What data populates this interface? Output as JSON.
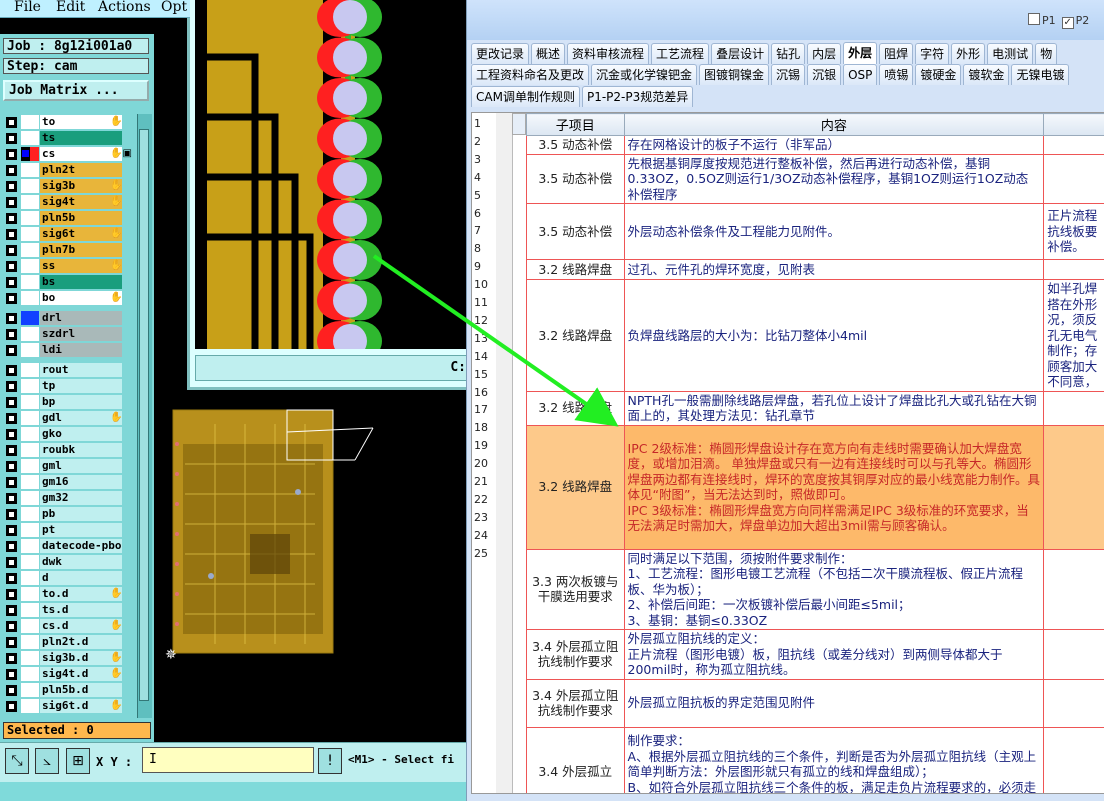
{
  "cam": {
    "menu": [
      "File",
      "Edit",
      "Actions",
      "Opt"
    ],
    "job": "Job : 8g12i001a0",
    "step": "Step: cam",
    "job_matrix_button": "Job Matrix ...",
    "layers": [
      {
        "name": "to",
        "swatch": "#ffffff",
        "bg": "#ffffff",
        "mark": "✋"
      },
      {
        "name": "ts",
        "swatch": "#ffffff",
        "bg": "#1a9e7d",
        "mark": ""
      },
      {
        "name": "cs",
        "swatch": "#ff2020",
        "bg": "#ffffff",
        "mark": "✋▣",
        "active": true
      },
      {
        "name": "pln2t",
        "swatch": "#ffffff",
        "bg": "#e8b53a",
        "mark": ""
      },
      {
        "name": "sig3b",
        "swatch": "#ffffff",
        "bg": "#e8b53a",
        "mark": "✋"
      },
      {
        "name": "sig4t",
        "swatch": "#ffffff",
        "bg": "#e8b53a",
        "mark": "✋"
      },
      {
        "name": "pln5b",
        "swatch": "#ffffff",
        "bg": "#e8b53a",
        "mark": ""
      },
      {
        "name": "sig6t",
        "swatch": "#ffffff",
        "bg": "#e8b53a",
        "mark": "✋"
      },
      {
        "name": "pln7b",
        "swatch": "#ffffff",
        "bg": "#e8b53a",
        "mark": ""
      },
      {
        "name": "ss",
        "swatch": "#ffffff",
        "bg": "#e8b53a",
        "mark": "✋"
      },
      {
        "name": "bs",
        "swatch": "#ffffff",
        "bg": "#1a9e7d",
        "mark": ""
      },
      {
        "name": "bo",
        "swatch": "#ffffff",
        "bg": "#ffffff",
        "mark": "✋"
      },
      {
        "gap": true
      },
      {
        "name": "drl",
        "swatch": "#1040ff",
        "bg": "#a9b9b9",
        "mark": ""
      },
      {
        "name": "szdrl",
        "swatch": "#ffffff",
        "bg": "#a9b9b9",
        "mark": ""
      },
      {
        "name": "ldi",
        "swatch": "#ffffff",
        "bg": "#a9b9b9",
        "mark": ""
      },
      {
        "gap": true
      },
      {
        "name": "rout",
        "swatch": "#ffffff",
        "bg": "#bfefef",
        "mark": ""
      },
      {
        "name": "tp",
        "swatch": "#ffffff",
        "bg": "#bfefef",
        "mark": ""
      },
      {
        "name": "bp",
        "swatch": "#ffffff",
        "bg": "#bfefef",
        "mark": ""
      },
      {
        "name": "gdl",
        "swatch": "#ffffff",
        "bg": "#bfefef",
        "mark": "✋"
      },
      {
        "name": "gko",
        "swatch": "#ffffff",
        "bg": "#bfefef",
        "mark": ""
      },
      {
        "name": "roubk",
        "swatch": "#ffffff",
        "bg": "#bfefef",
        "mark": ""
      },
      {
        "name": "gml",
        "swatch": "#ffffff",
        "bg": "#bfefef",
        "mark": ""
      },
      {
        "name": "gm16",
        "swatch": "#ffffff",
        "bg": "#bfefef",
        "mark": ""
      },
      {
        "name": "gm32",
        "swatch": "#ffffff",
        "bg": "#bfefef",
        "mark": ""
      },
      {
        "name": "pb",
        "swatch": "#ffffff",
        "bg": "#bfefef",
        "mark": ""
      },
      {
        "name": "pt",
        "swatch": "#ffffff",
        "bg": "#bfefef",
        "mark": ""
      },
      {
        "name": "datecode-pbo",
        "swatch": "#ffffff",
        "bg": "#bfefef",
        "mark": ""
      },
      {
        "name": "dwk",
        "swatch": "#ffffff",
        "bg": "#bfefef",
        "mark": ""
      },
      {
        "name": "d",
        "swatch": "#ffffff",
        "bg": "#bfefef",
        "mark": ""
      },
      {
        "name": "to.d",
        "swatch": "#ffffff",
        "bg": "#bfefef",
        "mark": "✋"
      },
      {
        "name": "ts.d",
        "swatch": "#ffffff",
        "bg": "#bfefef",
        "mark": ""
      },
      {
        "name": "cs.d",
        "swatch": "#ffffff",
        "bg": "#bfefef",
        "mark": "✋"
      },
      {
        "name": "pln2t.d",
        "swatch": "#ffffff",
        "bg": "#bfefef",
        "mark": ""
      },
      {
        "name": "sig3b.d",
        "swatch": "#ffffff",
        "bg": "#bfefef",
        "mark": "✋"
      },
      {
        "name": "sig4t.d",
        "swatch": "#ffffff",
        "bg": "#bfefef",
        "mark": "✋"
      },
      {
        "name": "pln5b.d",
        "swatch": "#ffffff",
        "bg": "#bfefef",
        "mark": ""
      },
      {
        "name": "sig6t.d",
        "swatch": "#ffffff",
        "bg": "#bfefef",
        "mark": "✋"
      }
    ],
    "selected": "Selected : 0",
    "xy_label": "X Y :",
    "xy_value": "I",
    "status": "<M1> - Select fi",
    "zoom_footer": "C:"
  },
  "spec": {
    "p_options": [
      {
        "label": "P1",
        "checked": false
      },
      {
        "label": "P2",
        "checked": true
      }
    ],
    "tabs_row1": [
      "更改记录",
      "概述",
      "资料审核流程",
      "工艺流程",
      "叠层设计",
      "钻孔",
      "内层",
      "外层",
      "阻焊",
      "字符",
      "外形",
      "电测试",
      "物"
    ],
    "active_tab": "外层",
    "tabs_row2": [
      "工程资料命名及更改",
      "沉金或化学镍钯金",
      "图镀铜镍金",
      "沉锡",
      "沉银",
      "OSP",
      "喷锡",
      "镀硬金",
      "镀软金",
      "无镍电镀"
    ],
    "tabs_row3": [
      "CAM调单制作规则",
      "P1-P2-P3规范差异"
    ],
    "row_numbers": [
      "1",
      "2",
      "3",
      "4",
      "5",
      "6",
      "7",
      "8",
      "9",
      "10",
      "11",
      "12",
      "13",
      "14",
      "15",
      "16",
      "17",
      "18",
      "19",
      "20",
      "21",
      "22",
      "23",
      "24",
      "25"
    ],
    "columns": [
      "子项目",
      "内容",
      ""
    ],
    "rows": [
      {
        "sub": "3.5 动态补偿",
        "content": [
          "存在网格设计的板子不运行（非军品）"
        ],
        "extra": ""
      },
      {
        "sub": "3.5 动态补偿",
        "content": [
          "先根据基铜厚度按规范进行整板补偿，然后再进行动态补偿，基铜0.33OZ，0.5OZ则运行1/3OZ动态补偿程序，基铜1OZ则运行1OZ动态补偿程序"
        ],
        "extra": ""
      },
      {
        "sub": "3.5 动态补偿",
        "content": [
          "外层动态补偿条件及工程能力见附件。"
        ],
        "extra": "正片流程抗线板要补偿。"
      },
      {
        "sub": "3.2 线路焊盘",
        "content": [
          "过孔、元件孔的焊环宽度，见附表"
        ],
        "extra": ""
      },
      {
        "sub": "3.2 线路焊盘",
        "content": [
          "负焊盘线路层的大小为：比钻刀整体小4mil"
        ],
        "extra": "如半孔焊搭在外形况，须反孔无电气制作；存顾客加大不同意，"
      },
      {
        "sub": "3.2 线路焊盘",
        "content": [
          "NPTH孔一般需删除线路层焊盘，若孔位上设计了焊盘比孔大或孔钻在大铜面上的，其处理方法见：钻孔章节"
        ],
        "extra": ""
      },
      {
        "sub": "3.2 线路焊盘",
        "content": [
          "IPC 2级标准：椭圆形焊盘设计存在宽方向有走线时需要确认加大焊盘宽度，或增加泪滴。 单独焊盘或只有一边有连接线时可以与孔等大。椭圆形焊盘两边都有连接线时，焊环的宽度按其铜厚对应的最小线宽能力制作。具体见“附图”，当无法达到时，照做即可。",
          "IPC 3级标准：椭圆形焊盘宽方向同样需满足IPC 3级标准的环宽要求，当无法满足时需加大，焊盘单边加大超出3mil需与顾客确认。"
        ],
        "extra": "",
        "highlight": true
      },
      {
        "sub": "3.3 两次板镀与干膜选用要求",
        "content": [
          "同时满足以下范围，须按附件要求制作：",
          "1、工艺流程：图形电镀工艺流程（不包括二次干膜流程板、假正片流程板、华为板）；",
          "2、补偿后间距：一次板镀补偿后最小间距≤5mil；",
          "3、基铜：基铜≤0.33OZ"
        ],
        "extra": ""
      },
      {
        "sub": "3.4 外层孤立阻抗线制作要求",
        "content": [
          "外层孤立阻抗线的定义：",
          "正片流程（图形电镀）板，阻抗线（或差分线对）到两侧导体都大于200mil时，称为孤立阻抗线。"
        ],
        "extra": ""
      },
      {
        "sub": "3.4 外层孤立阻抗线制作要求",
        "content": [
          "外层孤立阻抗板的界定范围见附件"
        ],
        "extra": ""
      },
      {
        "sub": "3.4 外层孤立",
        "content": [
          "制作要求：",
          "A、根据外层孤立阻抗线的三个条件，判断是否为外层孤立阻抗线（主观上简单判断方法：外层图形就只有孤立的线和焊盘组成）；",
          "B、如符合外层孤立阻抗线三个条件的板，满足走负片流程要求的，必须走负片流程；"
        ],
        "extra": ""
      }
    ]
  },
  "colors": {
    "cam_bg": "#7fd7d7",
    "copper": "#c8a018",
    "trace_green": "#2fb82f",
    "highlight_row": "#fdc98a",
    "arrow": "#22ee22"
  }
}
